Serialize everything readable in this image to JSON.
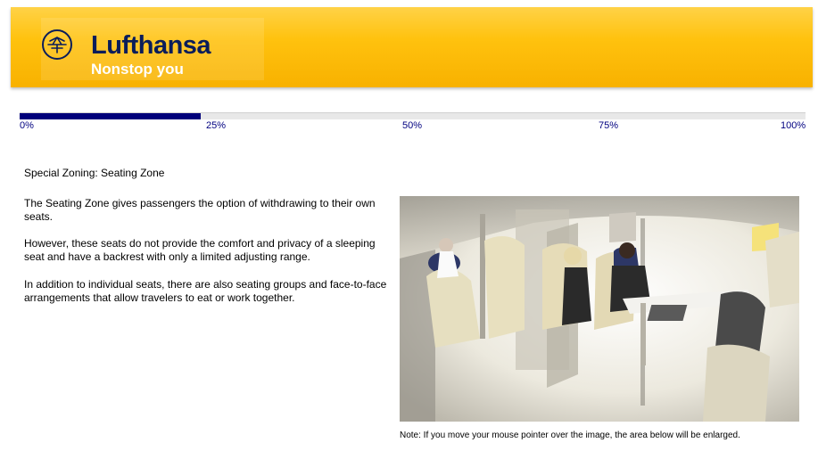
{
  "header": {
    "brand": "Lufthansa",
    "tagline": "Nonstop you",
    "logo_icon": "crane-logo-icon",
    "colors": {
      "bar": "#ffc20e",
      "brand": "#0a1d5a",
      "tagline": "#ffffff"
    }
  },
  "progress": {
    "value": 0.23,
    "fill_color": "#00007a",
    "ticks": [
      "0%",
      "25%",
      "50%",
      "75%",
      "100%"
    ]
  },
  "content": {
    "title": "Special Zoning: Seating Zone",
    "paragraphs": [
      "The Seating Zone gives passengers the option of withdrawing to their own seats.",
      "However, these seats do not provide the comfort and privacy of a sleeping seat and have a backrest with only a limited adjusting range.",
      "In addition to individual seats, there are also seating groups and face-to-face arrangements that allow travelers to eat or work together."
    ]
  },
  "image": {
    "note": "Note: If you move your mouse pointer over the image, the area below will be enlarged."
  }
}
